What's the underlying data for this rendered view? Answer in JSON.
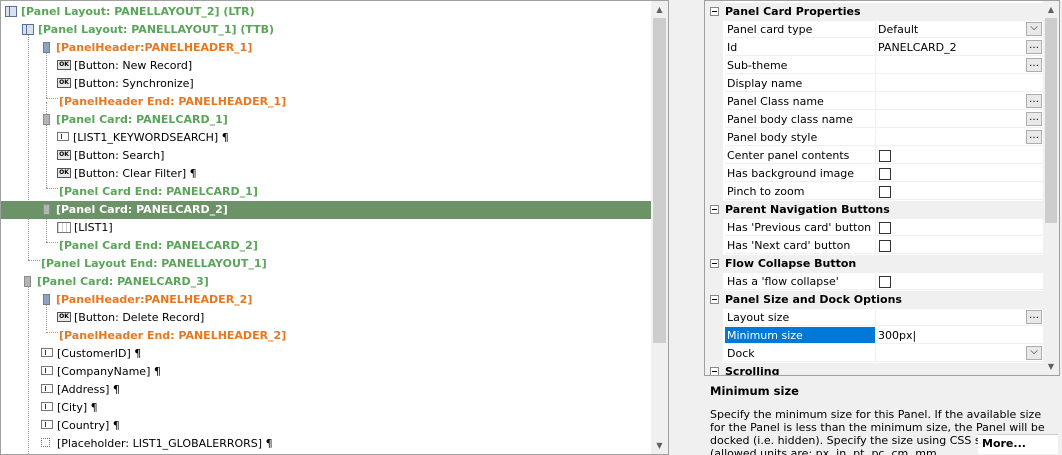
{
  "tree": {
    "rows": [
      {
        "text": "[Panel Layout: PANELLAYOUT_2] (LTR)",
        "cls": "g",
        "icon": "layout"
      },
      {
        "text": "[Panel Layout: PANELLAYOUT_1] (TTB)",
        "cls": "g",
        "icon": "layout"
      },
      {
        "text": "[PanelHeader:PANELHEADER_1]",
        "cls": "o",
        "icon": "hdr"
      },
      {
        "text": "[Button: New Record]",
        "cls": "k",
        "icon": "ok"
      },
      {
        "text": "[Button: Synchronize]",
        "cls": "k",
        "icon": "ok"
      },
      {
        "text": "[PanelHeader End: PANELHEADER_1]",
        "cls": "o",
        "icon": ""
      },
      {
        "text": "[Panel Card: PANELCARD_1]",
        "cls": "g",
        "icon": "card"
      },
      {
        "text": "[LIST1_KEYWORDSEARCH]",
        "cls": "k",
        "icon": "txt",
        "pil": true
      },
      {
        "text": "[Button: Search]",
        "cls": "k",
        "icon": "ok"
      },
      {
        "text": "[Button: Clear Filter]",
        "cls": "k",
        "icon": "ok",
        "pil": true
      },
      {
        "text": "[Panel Card End: PANELCARD_1]",
        "cls": "g",
        "icon": ""
      },
      {
        "text": "[Panel Card: PANELCARD_2]",
        "cls": "g",
        "icon": "card",
        "selected": true
      },
      {
        "text": "[LIST1]",
        "cls": "k",
        "icon": "grid"
      },
      {
        "text": "[Panel Card End: PANELCARD_2]",
        "cls": "g",
        "icon": ""
      },
      {
        "text": "[Panel Layout End: PANELLAYOUT_1]",
        "cls": "g",
        "icon": ""
      },
      {
        "text": "[Panel Card: PANELCARD_3]",
        "cls": "g",
        "icon": "card"
      },
      {
        "text": "[PanelHeader:PANELHEADER_2]",
        "cls": "o",
        "icon": "hdr"
      },
      {
        "text": "[Button: Delete Record]",
        "cls": "k",
        "icon": "ok"
      },
      {
        "text": "[PanelHeader End: PANELHEADER_2]",
        "cls": "o",
        "icon": ""
      },
      {
        "text": "[CustomerID]",
        "cls": "k",
        "icon": "txt",
        "pil": true
      },
      {
        "text": "[CompanyName]",
        "cls": "k",
        "icon": "txt",
        "pil": true
      },
      {
        "text": "[Address]",
        "cls": "k",
        "icon": "txt",
        "pil": true
      },
      {
        "text": "[City]",
        "cls": "k",
        "icon": "txt",
        "pil": true
      },
      {
        "text": "[Country]",
        "cls": "k",
        "icon": "txt",
        "pil": true
      },
      {
        "text": "[Placeholder: LIST1_GLOBALERRORS]",
        "cls": "k",
        "icon": "ph",
        "pil": true
      }
    ],
    "pilcrow": "¶",
    "ok_glyph": "OK"
  },
  "props": {
    "sections": [
      {
        "title": "Panel Card Properties",
        "rows": [
          {
            "name": "Panel card type",
            "value": "Default",
            "ctrl": "drop"
          },
          {
            "name": "Id",
            "value": "PANELCARD_2",
            "ctrl": "dots"
          },
          {
            "name": "Sub-theme",
            "value": "",
            "ctrl": "dots"
          },
          {
            "name": "Display name",
            "value": "",
            "ctrl": ""
          },
          {
            "name": "Panel Class name",
            "value": "",
            "ctrl": "dots"
          },
          {
            "name": "Panel body class name",
            "value": "",
            "ctrl": "dots"
          },
          {
            "name": "Panel body style",
            "value": "",
            "ctrl": "dots"
          },
          {
            "name": "Center panel contents",
            "value": "",
            "ctrl": "chk"
          },
          {
            "name": "Has background image",
            "value": "",
            "ctrl": "chk"
          },
          {
            "name": "Pinch to zoom",
            "value": "",
            "ctrl": "chk"
          }
        ]
      },
      {
        "title": "Parent Navigation Buttons",
        "rows": [
          {
            "name": "Has 'Previous card' button",
            "value": "",
            "ctrl": "chk"
          },
          {
            "name": "Has 'Next card' button",
            "value": "",
            "ctrl": "chk"
          }
        ]
      },
      {
        "title": "Flow Collapse Button",
        "rows": [
          {
            "name": "Has a 'flow collapse' button",
            "value": "",
            "ctrl": "chk"
          }
        ]
      },
      {
        "title": "Panel Size and Dock Options",
        "rows": [
          {
            "name": "Layout size",
            "value": "",
            "ctrl": "dots"
          },
          {
            "name": "Minimum size",
            "value": "300px",
            "ctrl": "",
            "selected": true
          },
          {
            "name": "Dock",
            "value": "",
            "ctrl": "drop"
          }
        ]
      },
      {
        "title": "Scrolling",
        "rows": []
      }
    ],
    "dots_glyph": "…",
    "drop_glyph": "⌵"
  },
  "help": {
    "title": "Minimum size",
    "description": "Specify the minimum size for this Panel. If the available size for the Panel is less than the minimum size, the Panel will be docked (i.e. hidden). Specify the size using CSS syntax (allowed units are: px, in, pt, pc, cm, mm",
    "more": "More..."
  }
}
